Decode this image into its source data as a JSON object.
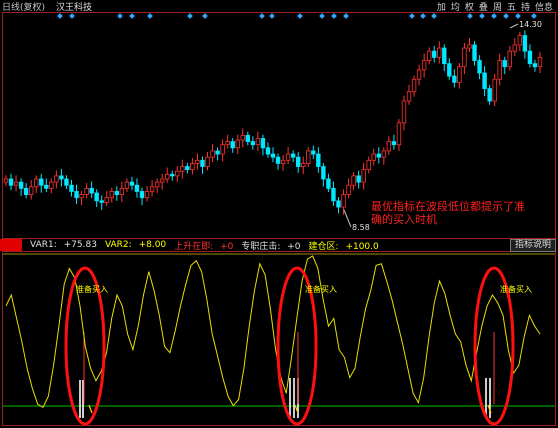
{
  "header": {
    "period_label": "日线(复权)",
    "stock_name": "汉王科技",
    "tools": [
      "加",
      "均",
      "权",
      "叠",
      "周",
      "五",
      "持",
      "信息"
    ]
  },
  "price_panel": {
    "high_label": "14.30",
    "low_label": "8.58",
    "annotation": [
      "最优指标在波段低位都提示了准",
      "确的买入时机"
    ]
  },
  "indicator_bar": {
    "items": [
      {
        "label": "VAR1: ",
        "value": "+75.83",
        "color": "#e0e0e0"
      },
      {
        "label": "VAR2: ",
        "value": "+8.00",
        "color": "#ffff00"
      },
      {
        "label": "上升在即: ",
        "value": "+0",
        "color": "#ff3030"
      },
      {
        "label": "专职庄击: ",
        "value": "+0",
        "color": "#e0e0e0"
      },
      {
        "label": "建仓区: ",
        "value": "+100.0",
        "color": "#ffff00"
      }
    ],
    "explain_button": "指标说明"
  },
  "indicator_panel": {
    "buy_labels": [
      "准备买入",
      "准备买入",
      "准备买入"
    ]
  },
  "chart_data": {
    "type": "candlestick",
    "price": {
      "ylim": [
        8.0,
        14.8
      ],
      "high": 14.3,
      "low": 8.58,
      "closes": [
        9.7,
        9.5,
        9.6,
        9.4,
        9.2,
        9.45,
        9.7,
        9.5,
        9.4,
        9.6,
        9.8,
        9.7,
        9.5,
        9.3,
        9.1,
        9.2,
        9.4,
        9.25,
        9.0,
        8.95,
        9.1,
        9.3,
        9.2,
        9.4,
        9.6,
        9.5,
        9.3,
        9.1,
        9.3,
        9.45,
        9.6,
        9.7,
        9.85,
        9.8,
        9.95,
        10.1,
        10.0,
        10.2,
        10.3,
        10.1,
        10.4,
        10.6,
        10.5,
        10.8,
        10.9,
        10.7,
        10.95,
        11.1,
        10.9,
        10.8,
        11.0,
        10.7,
        10.5,
        10.4,
        10.2,
        10.3,
        10.5,
        10.4,
        10.1,
        10.2,
        10.6,
        10.5,
        10.1,
        9.7,
        9.4,
        9.0,
        8.8,
        9.2,
        9.5,
        9.8,
        9.6,
        10.0,
        10.3,
        10.5,
        10.4,
        10.6,
        10.9,
        10.8,
        11.5,
        12.2,
        12.5,
        12.9,
        13.2,
        13.5,
        13.8,
        13.6,
        13.9,
        13.4,
        13.0,
        12.8,
        13.3,
        13.9,
        14.0,
        13.5,
        13.1,
        12.6,
        12.2,
        12.9,
        13.5,
        13.3,
        13.8,
        14.0,
        14.3,
        13.8,
        13.4,
        13.3,
        13.6
      ]
    },
    "indicator": {
      "ylim": [
        0,
        100
      ],
      "var1_series": [
        68,
        75,
        60,
        45,
        28,
        15,
        5,
        3,
        10,
        30,
        55,
        82,
        92,
        86,
        68,
        42,
        28,
        20,
        26,
        38,
        60,
        75,
        68,
        50,
        40,
        55,
        75,
        90,
        78,
        62,
        42,
        38,
        52,
        68,
        82,
        94,
        97,
        90,
        72,
        50,
        36,
        22,
        10,
        4,
        8,
        28,
        55,
        78,
        95,
        88,
        66,
        40,
        22,
        12,
        35,
        60,
        84,
        98,
        100,
        92,
        72,
        55,
        60,
        40,
        35,
        22,
        28,
        48,
        66,
        78,
        94,
        95,
        84,
        72,
        58,
        44,
        28,
        12,
        6,
        22,
        48,
        70,
        84,
        76,
        62,
        50,
        45,
        30,
        20,
        38,
        55,
        68,
        75,
        70,
        62,
        40,
        25,
        30,
        48,
        62,
        55,
        50
      ]
    },
    "signal_events": [
      {
        "label": "准备买入"
      },
      {
        "label": "准备买入"
      },
      {
        "label": "准备买入"
      }
    ]
  }
}
